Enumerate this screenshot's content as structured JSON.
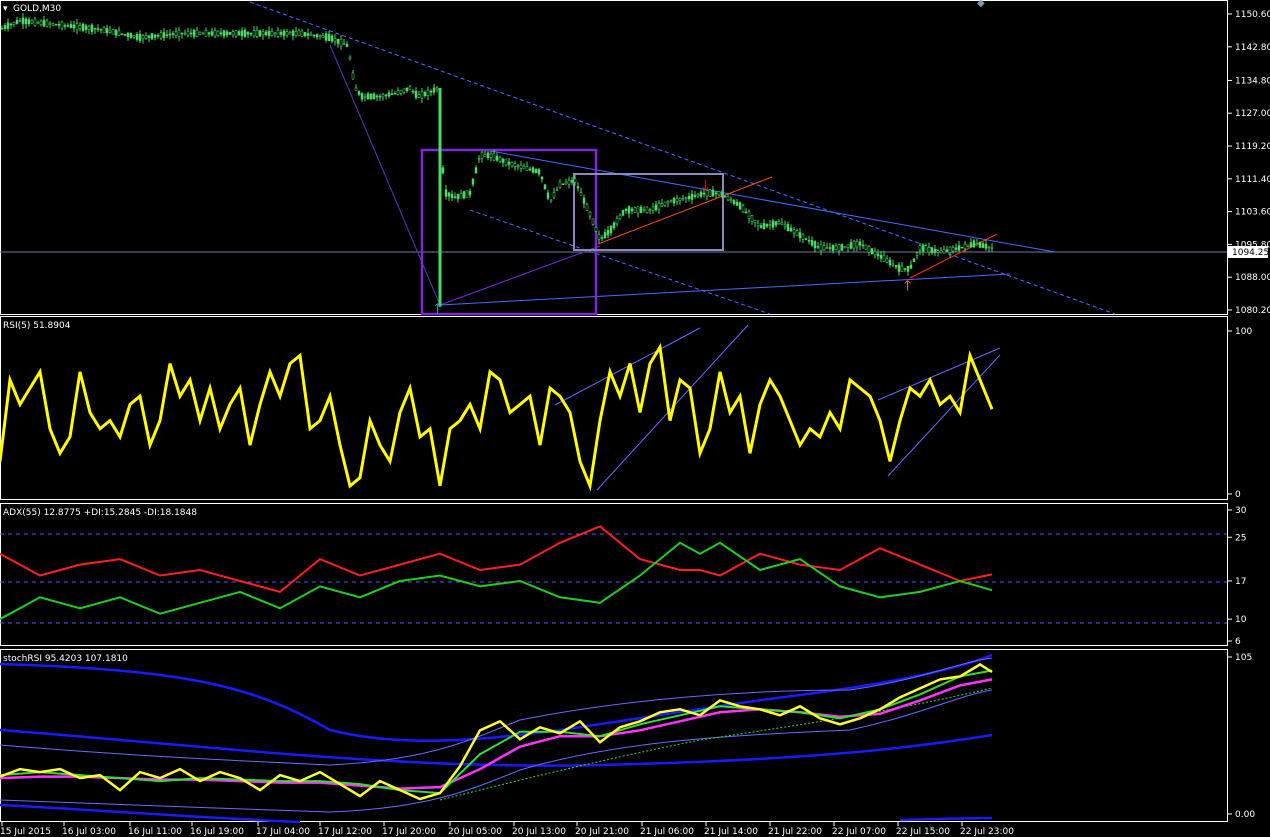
{
  "symbol_title": "GOLD,M30",
  "current_price": "1094.25",
  "colors": {
    "background": "#000000",
    "frame": "#ffffff",
    "candle": "#4cd964",
    "rsi": "#ffff00",
    "adx_plus": "#22cc22",
    "adx_minus": "#ff2020",
    "stoch_main": "#ffff33",
    "stoch_signal": "#33dd33",
    "stoch_ma": "#ff33ff",
    "band_outer": "#1a1aff",
    "band_inner": "#6a6aff",
    "trend_line": "#4a4aff",
    "purple_box": "#7a2bd6",
    "grey_box": "#8a8ab8",
    "orange_line": "#ff5500",
    "arrow_up": "#33aaff",
    "arrow_down": "#ff2222",
    "arrow_orange": "#ff9900"
  },
  "x_labels": [
    "15 Jul 2015",
    "16 Jul 03:00",
    "16 Jul 11:00",
    "16 Jul 19:00",
    "17 Jul 04:00",
    "17 Jul 12:00",
    "17 Jul 20:00",
    "20 Jul 05:00",
    "20 Jul 13:00",
    "20 Jul 21:00",
    "21 Jul 06:00",
    "21 Jul 14:00",
    "21 Jul 22:00",
    "22 Jul 07:00",
    "22 Jul 15:00",
    "22 Jul 23:00"
  ],
  "chart_data": [
    {
      "type": "candlestick",
      "title": "GOLD,M30",
      "ylim": [
        1080.2,
        1150.6
      ],
      "y_ticks": [
        "1150.60",
        "1142.80",
        "1134.80",
        "1127.00",
        "1119.20",
        "1111.40",
        "1103.60",
        "1095.80",
        "1088.00",
        "1080.20"
      ],
      "close_path": [
        [
          0,
          1147
        ],
        [
          20,
          1149
        ],
        [
          60,
          1148
        ],
        [
          100,
          1147
        ],
        [
          140,
          1145
        ],
        [
          180,
          1146
        ],
        [
          220,
          1146
        ],
        [
          260,
          1146
        ],
        [
          300,
          1146
        ],
        [
          330,
          1145
        ],
        [
          348,
          1143
        ],
        [
          355,
          1133
        ],
        [
          362,
          1131
        ],
        [
          380,
          1131
        ],
        [
          400,
          1132
        ],
        [
          410,
          1133
        ],
        [
          418,
          1131
        ],
        [
          430,
          1132
        ],
        [
          438,
          1133
        ],
        [
          440,
          1082
        ],
        [
          441,
          1117
        ],
        [
          446,
          1108
        ],
        [
          455,
          1107
        ],
        [
          470,
          1108
        ],
        [
          480,
          1117
        ],
        [
          490,
          1117
        ],
        [
          510,
          1115
        ],
        [
          540,
          1113
        ],
        [
          550,
          1106
        ],
        [
          560,
          1110
        ],
        [
          575,
          1111
        ],
        [
          590,
          1103
        ],
        [
          600,
          1097
        ],
        [
          610,
          1099
        ],
        [
          625,
          1104
        ],
        [
          650,
          1104
        ],
        [
          670,
          1106
        ],
        [
          690,
          1107
        ],
        [
          705,
          1108
        ],
        [
          720,
          1108
        ],
        [
          740,
          1105
        ],
        [
          760,
          1100
        ],
        [
          780,
          1101
        ],
        [
          800,
          1098
        ],
        [
          820,
          1095
        ],
        [
          840,
          1095
        ],
        [
          860,
          1096
        ],
        [
          880,
          1093
        ],
        [
          900,
          1090
        ],
        [
          910,
          1090
        ],
        [
          920,
          1095
        ],
        [
          940,
          1094
        ],
        [
          960,
          1095
        ],
        [
          975,
          1096
        ],
        [
          992,
          1095
        ]
      ]
    },
    {
      "type": "line",
      "title": "RSI(5) 51.8904",
      "ylim": [
        0,
        100
      ],
      "y_ticks": [
        "100",
        "0"
      ],
      "series": [
        {
          "name": "RSI(5)",
          "x": [
            0,
            10,
            20,
            30,
            40,
            50,
            60,
            70,
            80,
            90,
            100,
            110,
            120,
            130,
            140,
            150,
            160,
            170,
            180,
            190,
            200,
            210,
            220,
            230,
            240,
            250,
            260,
            270,
            280,
            290,
            300,
            310,
            320,
            330,
            340,
            350,
            360,
            370,
            380,
            390,
            400,
            410,
            420,
            430,
            440,
            450,
            460,
            470,
            480,
            490,
            500,
            510,
            520,
            530,
            540,
            550,
            560,
            570,
            580,
            590,
            600,
            610,
            620,
            630,
            640,
            650,
            660,
            670,
            680,
            690,
            700,
            710,
            720,
            730,
            740,
            750,
            760,
            770,
            780,
            790,
            800,
            810,
            820,
            830,
            840,
            850,
            860,
            870,
            880,
            890,
            900,
            910,
            920,
            930,
            940,
            950,
            960,
            970,
            980,
            992
          ],
          "values": [
            20,
            70,
            55,
            65,
            75,
            40,
            25,
            35,
            75,
            50,
            40,
            45,
            35,
            55,
            60,
            30,
            45,
            80,
            60,
            70,
            45,
            65,
            40,
            55,
            65,
            30,
            55,
            75,
            60,
            80,
            85,
            40,
            45,
            60,
            30,
            5,
            10,
            45,
            30,
            20,
            50,
            65,
            35,
            40,
            5,
            40,
            45,
            55,
            40,
            75,
            70,
            50,
            55,
            60,
            30,
            65,
            60,
            50,
            20,
            5,
            45,
            75,
            60,
            80,
            50,
            80,
            90,
            45,
            70,
            65,
            25,
            40,
            75,
            50,
            60,
            25,
            55,
            70,
            60,
            45,
            30,
            40,
            35,
            50,
            40,
            70,
            65,
            60,
            45,
            20,
            45,
            65,
            60,
            70,
            55,
            60,
            50,
            85,
            70,
            52
          ]
        }
      ]
    },
    {
      "type": "line",
      "title": "ADX(55) 12.8775 +DI:15.2845 -DI:18.1848",
      "ylim": [
        6,
        30
      ],
      "y_ticks": [
        "30",
        "25",
        "17",
        "10",
        "6"
      ],
      "series": [
        {
          "name": "+DI",
          "x": [
            0,
            40,
            80,
            120,
            160,
            200,
            240,
            280,
            320,
            360,
            400,
            440,
            480,
            520,
            560,
            600,
            640,
            680,
            700,
            720,
            760,
            800,
            840,
            880,
            920,
            960,
            992
          ],
          "values": [
            10,
            14,
            12,
            14,
            11,
            13,
            15,
            12,
            16,
            14,
            17,
            18,
            16,
            17,
            14,
            13,
            18,
            24,
            22,
            24,
            19,
            21,
            16,
            14,
            15,
            17,
            15.3
          ]
        },
        {
          "name": "-DI",
          "x": [
            0,
            40,
            80,
            120,
            160,
            200,
            240,
            280,
            320,
            360,
            400,
            440,
            480,
            520,
            560,
            600,
            640,
            680,
            700,
            720,
            760,
            800,
            840,
            880,
            920,
            960,
            992
          ],
          "values": [
            22,
            18,
            20,
            21,
            18,
            19,
            17,
            15,
            21,
            18,
            20,
            22,
            19,
            20,
            24,
            27,
            21,
            19,
            19,
            18,
            22,
            20,
            19,
            23,
            20,
            17,
            18.2
          ]
        }
      ]
    },
    {
      "type": "line",
      "title": "stochRSI 95.4203 107.1810",
      "ylim": [
        0,
        105
      ],
      "y_ticks": [
        "105",
        "0.00"
      ],
      "series": [
        {
          "name": "stochRSI",
          "x": [
            0,
            20,
            40,
            60,
            80,
            100,
            120,
            140,
            160,
            180,
            200,
            220,
            240,
            260,
            280,
            300,
            320,
            340,
            360,
            380,
            400,
            420,
            440,
            460,
            480,
            500,
            520,
            540,
            560,
            580,
            600,
            620,
            640,
            660,
            680,
            700,
            720,
            740,
            760,
            780,
            800,
            820,
            840,
            860,
            880,
            900,
            920,
            940,
            960,
            980,
            992
          ],
          "values": [
            25,
            30,
            28,
            30,
            24,
            26,
            16,
            28,
            24,
            30,
            22,
            28,
            24,
            16,
            26,
            22,
            28,
            20,
            12,
            22,
            16,
            10,
            14,
            32,
            56,
            62,
            50,
            58,
            54,
            62,
            48,
            58,
            62,
            68,
            70,
            66,
            76,
            72,
            70,
            66,
            72,
            64,
            60,
            64,
            70,
            78,
            84,
            90,
            92,
            100,
            95
          ]
        },
        {
          "name": "signal",
          "x": [
            0,
            40,
            80,
            120,
            160,
            200,
            240,
            280,
            320,
            360,
            400,
            440,
            480,
            520,
            560,
            600,
            640,
            680,
            720,
            760,
            800,
            840,
            880,
            920,
            960,
            992
          ],
          "values": [
            26,
            28,
            26,
            24,
            22,
            24,
            23,
            22,
            22,
            20,
            16,
            14,
            40,
            55,
            55,
            52,
            60,
            66,
            72,
            70,
            68,
            64,
            70,
            80,
            92,
            96
          ]
        },
        {
          "name": "MA",
          "x": [
            0,
            40,
            80,
            120,
            160,
            200,
            240,
            280,
            320,
            360,
            400,
            440,
            480,
            520,
            560,
            600,
            640,
            680,
            720,
            760,
            800,
            840,
            880,
            920,
            960,
            992
          ],
          "values": [
            24,
            25,
            25,
            24,
            23,
            23,
            22,
            21,
            21,
            19,
            17,
            18,
            30,
            45,
            52,
            52,
            56,
            62,
            68,
            70,
            68,
            65,
            67,
            76,
            86,
            90
          ]
        }
      ]
    }
  ]
}
